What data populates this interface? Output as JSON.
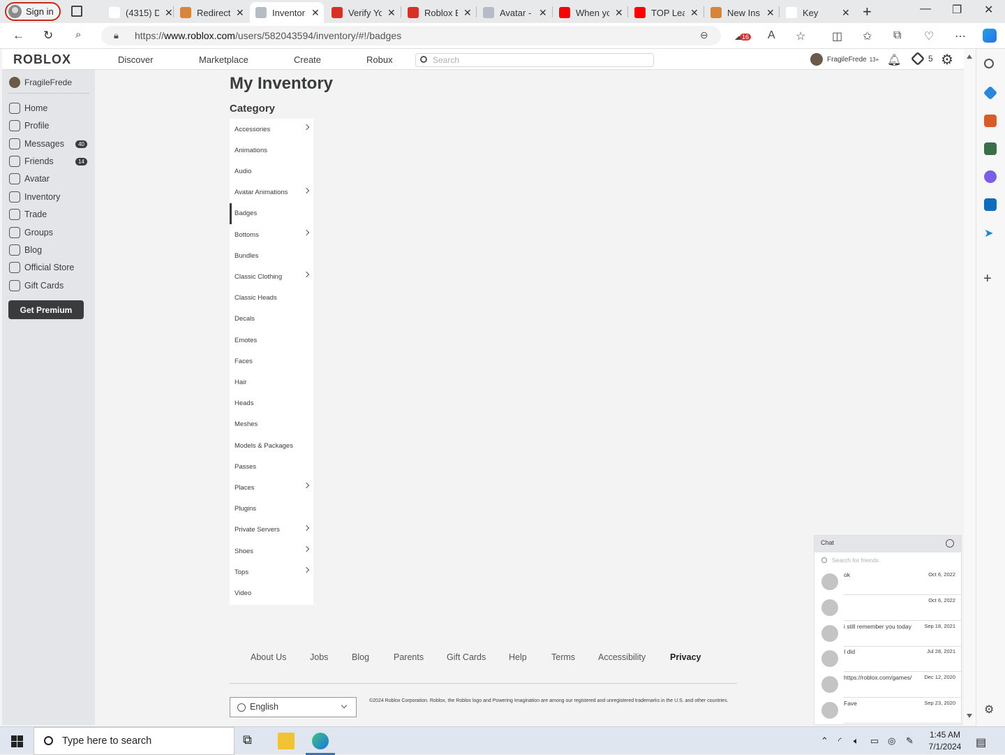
{
  "browser": {
    "signin_label": "Sign in",
    "tabs": [
      {
        "title": "(4315) D",
        "color": "#ffffff"
      },
      {
        "title": "Redirect",
        "color": "#d9843b"
      },
      {
        "title": "Inventor",
        "color": "#b6bcc6"
      },
      {
        "title": "Verify Yo",
        "color": "#d93025"
      },
      {
        "title": "Roblox E",
        "color": "#d93025"
      },
      {
        "title": "Avatar -",
        "color": "#b6bcc6"
      },
      {
        "title": "When yo",
        "color": "#ff0000"
      },
      {
        "title": "TOP Lea",
        "color": "#ff0000"
      },
      {
        "title": "New Ins",
        "color": "#d9843b"
      },
      {
        "title": "Key",
        "color": "#ffffff"
      }
    ],
    "url_prefix": "https://",
    "url_host": "www.roblox.com",
    "url_path": "/users/582043594/inventory/#!/badges",
    "collections_badge": "16"
  },
  "header": {
    "logo": "ROBLOX",
    "nav": [
      "Discover",
      "Marketplace",
      "Create",
      "Robux"
    ],
    "search_placeholder": "Search",
    "username": "FragileFrede",
    "age_tag": "13+",
    "robux_count": "5"
  },
  "leftnav": {
    "username": "FragileFrede",
    "items": [
      {
        "label": "Home",
        "badge": ""
      },
      {
        "label": "Profile",
        "badge": ""
      },
      {
        "label": "Messages",
        "badge": "40"
      },
      {
        "label": "Friends",
        "badge": "14"
      },
      {
        "label": "Avatar",
        "badge": ""
      },
      {
        "label": "Inventory",
        "badge": ""
      },
      {
        "label": "Trade",
        "badge": ""
      },
      {
        "label": "Groups",
        "badge": ""
      },
      {
        "label": "Blog",
        "badge": ""
      },
      {
        "label": "Official Store",
        "badge": ""
      },
      {
        "label": "Gift Cards",
        "badge": ""
      }
    ],
    "premium_label": "Get Premium"
  },
  "main": {
    "title": "My Inventory",
    "category_title": "Category",
    "selected": "Badges",
    "categories": [
      {
        "label": "Accessories",
        "chevron": true
      },
      {
        "label": "Animations",
        "chevron": false
      },
      {
        "label": "Audio",
        "chevron": false
      },
      {
        "label": "Avatar Animations",
        "chevron": true
      },
      {
        "label": "Badges",
        "chevron": false
      },
      {
        "label": "Bottoms",
        "chevron": true
      },
      {
        "label": "Bundles",
        "chevron": false
      },
      {
        "label": "Classic Clothing",
        "chevron": true
      },
      {
        "label": "Classic Heads",
        "chevron": false
      },
      {
        "label": "Decals",
        "chevron": false
      },
      {
        "label": "Emotes",
        "chevron": false
      },
      {
        "label": "Faces",
        "chevron": false
      },
      {
        "label": "Hair",
        "chevron": false
      },
      {
        "label": "Heads",
        "chevron": false
      },
      {
        "label": "Meshes",
        "chevron": false
      },
      {
        "label": "Models & Packages",
        "chevron": false
      },
      {
        "label": "Passes",
        "chevron": false
      },
      {
        "label": "Places",
        "chevron": true
      },
      {
        "label": "Plugins",
        "chevron": false
      },
      {
        "label": "Private Servers",
        "chevron": true
      },
      {
        "label": "Shoes",
        "chevron": true
      },
      {
        "label": "Tops",
        "chevron": true
      },
      {
        "label": "Video",
        "chevron": false
      }
    ]
  },
  "footer": {
    "links": [
      "About Us",
      "Jobs",
      "Blog",
      "Parents",
      "Gift Cards",
      "Help",
      "Terms",
      "Accessibility",
      "Privacy"
    ],
    "language": "English",
    "copyright": "©2024 Roblox Corporation. Roblox, the Roblox logo and Powering Imagination are among our registered and unregistered trademarks in the U.S. and other countries."
  },
  "chat": {
    "title": "Chat",
    "search_placeholder": "Search for friends",
    "conversations": [
      {
        "message": "ok",
        "date": "Oct 6, 2022"
      },
      {
        "message": "",
        "date": "Oct 6, 2022"
      },
      {
        "message": "i still remember you today",
        "date": "Sep 18, 2021"
      },
      {
        "message": "I did",
        "date": "Jul 28, 2021"
      },
      {
        "message": "https://roblox.com/games/",
        "date": "Dec 12, 2020"
      },
      {
        "message": "Fave",
        "date": "Sep 23, 2020"
      }
    ]
  },
  "taskbar": {
    "search_placeholder": "Type here to search",
    "time": "1:45 AM",
    "date": "7/1/2024"
  }
}
